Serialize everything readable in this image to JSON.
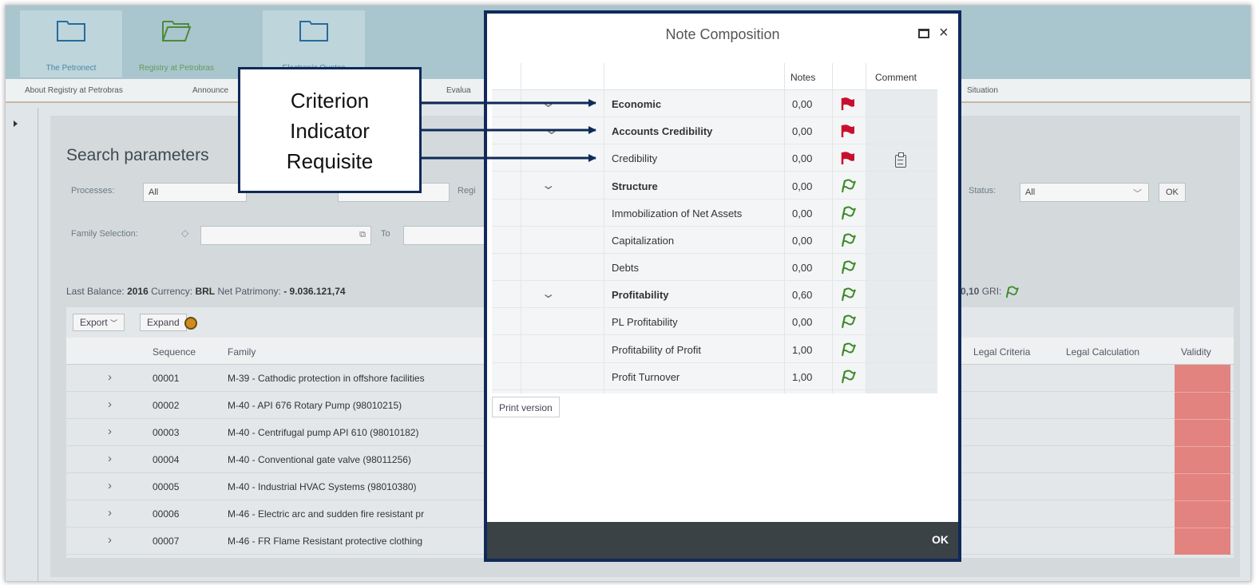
{
  "tabs": [
    {
      "label": "The Petronect"
    },
    {
      "label": "Registry at Petrobras"
    },
    {
      "label": "Electronic Quotes"
    }
  ],
  "subnav": {
    "about": "About Registry at Petrobras",
    "announce": "Announce",
    "evaluation": "Evalua",
    "situation": "Situation"
  },
  "search": {
    "title": "Search parameters",
    "processes_label": "Processes:",
    "processes_value": "All",
    "regi_label": "Regi",
    "status_label": "Status:",
    "status_value": "All",
    "ok_label": "OK",
    "family_label": "Family Selection:",
    "to_label": "To"
  },
  "balance": {
    "last_balance_label": "Last Balance:",
    "last_balance_value": "2016",
    "currency_label": "Currency:",
    "currency_value": "BRL",
    "net_label": "Net Patrimony:",
    "net_value": "- 9.036.121,74",
    "tail_value": "0,10",
    "gri_label": "GRI:"
  },
  "table": {
    "export_label": "Export",
    "expand_label": "Expand",
    "headers": {
      "sequence": "Sequence",
      "family": "Family",
      "legal_criteria": "Legal Criteria",
      "legal_calc": "Legal Calculation",
      "validity": "Validity"
    },
    "rows": [
      {
        "seq": "00001",
        "family": "M-39 - Cathodic protection in offshore facilities"
      },
      {
        "seq": "00002",
        "family": "M-40 - API 676 Rotary Pump (98010215)"
      },
      {
        "seq": "00003",
        "family": "M-40 - Centrifugal pump API 610 (98010182)"
      },
      {
        "seq": "00004",
        "family": "M-40 - Conventional gate valve (98011256)"
      },
      {
        "seq": "00005",
        "family": "M-40 - Industrial HVAC Systems (98010380)"
      },
      {
        "seq": "00006",
        "family": "M-46 - Electric arc and sudden fire resistant pr"
      },
      {
        "seq": "00007",
        "family": "M-46 - FR Flame Resistant protective clothing"
      }
    ]
  },
  "modal": {
    "title": "Note Composition",
    "col_notes": "Notes",
    "col_comment": "Comment",
    "rows": [
      {
        "label": "Economic",
        "note": "0,00",
        "flag": "red",
        "bold": true
      },
      {
        "label": "Accounts Credibility",
        "note": "0,00",
        "flag": "red",
        "bold": true
      },
      {
        "label": "Credibility",
        "note": "0,00",
        "flag": "red",
        "bold": false
      },
      {
        "label": "Structure",
        "note": "0,00",
        "flag": "green",
        "bold": true
      },
      {
        "label": "Immobilization of Net Assets",
        "note": "0,00",
        "flag": "green",
        "bold": false
      },
      {
        "label": "Capitalization",
        "note": "0,00",
        "flag": "green",
        "bold": false
      },
      {
        "label": "Debts",
        "note": "0,00",
        "flag": "green",
        "bold": false
      },
      {
        "label": "Profitability",
        "note": "0,60",
        "flag": "green",
        "bold": true
      },
      {
        "label": "PL Profitability",
        "note": "0,00",
        "flag": "green",
        "bold": false
      },
      {
        "label": "Profitability of Profit",
        "note": "1,00",
        "flag": "green",
        "bold": false
      },
      {
        "label": "Profit Turnover",
        "note": "1,00",
        "flag": "green",
        "bold": false
      }
    ],
    "print_label": "Print version",
    "ok_label": "OK"
  },
  "callout": {
    "line1": "Criterion",
    "line2": "Indicator",
    "line3": "Requisite"
  },
  "colors": {
    "navy": "#0f2a5a",
    "flag_red": "#c8102e",
    "flag_green": "#3d8b2a",
    "validity_red": "#e28380"
  }
}
